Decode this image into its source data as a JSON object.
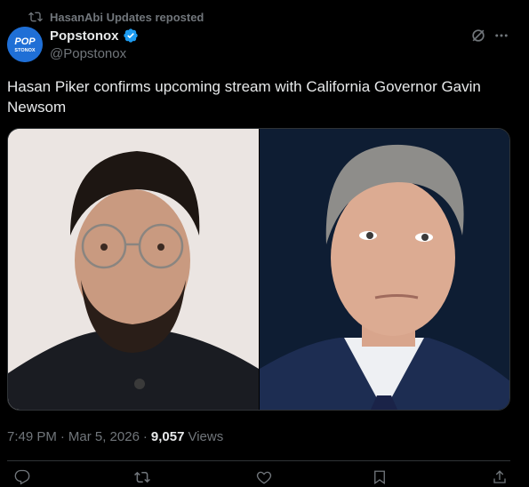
{
  "repost": {
    "label": "HasanAbi Updates reposted",
    "icon": "repost-icon"
  },
  "author": {
    "name": "Popstonox",
    "handle": "@Popstonox",
    "avatar_text_top": "POP",
    "avatar_text_bottom": "STONOX",
    "verified": true,
    "avatar_color": "#1f6fd6",
    "verified_color": "#1d9bf0"
  },
  "tweet": {
    "text": "Hasan Piker confirms upcoming stream with California Governor Gavin Newsom"
  },
  "media": {
    "images": [
      {
        "name": "photo-left",
        "description_icon": "portrait-photo"
      },
      {
        "name": "photo-right",
        "description_icon": "portrait-photo"
      }
    ]
  },
  "meta": {
    "time": "7:49 PM",
    "date": "Mar 5, 2026",
    "views_count": "9,057",
    "views_label": "Views"
  },
  "colors": {
    "background": "#000000",
    "text_primary": "#e7e9ea",
    "text_secondary": "#71767b",
    "border": "#2f3336"
  }
}
